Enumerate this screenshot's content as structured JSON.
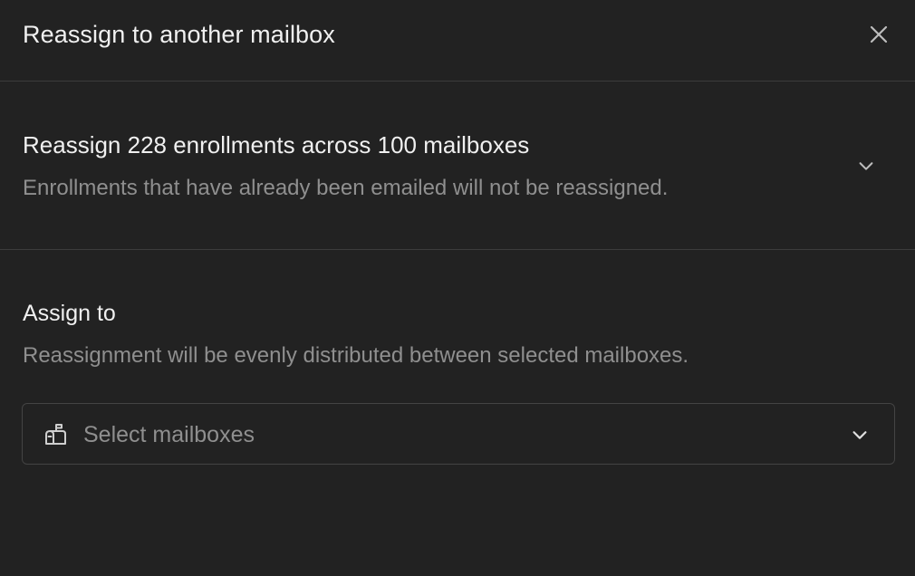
{
  "dialog": {
    "title": "Reassign to another mailbox",
    "close_icon": "close-icon"
  },
  "summary": {
    "title": "Reassign 228 enrollments across 100 mailboxes",
    "subtitle": "Enrollments that have already been emailed will not be reassigned.",
    "expand_icon": "chevron-down-icon"
  },
  "assign": {
    "label": "Assign to",
    "help": "Reassignment will be evenly distributed between selected mailboxes.",
    "select": {
      "placeholder": "Select mailboxes",
      "icon": "mailbox-icon",
      "chevron_icon": "chevron-down-icon"
    }
  },
  "colors": {
    "background": "#222222",
    "divider": "#3c3c3c",
    "text_primary": "#f0f0f0",
    "text_secondary": "#8f8f8f"
  }
}
